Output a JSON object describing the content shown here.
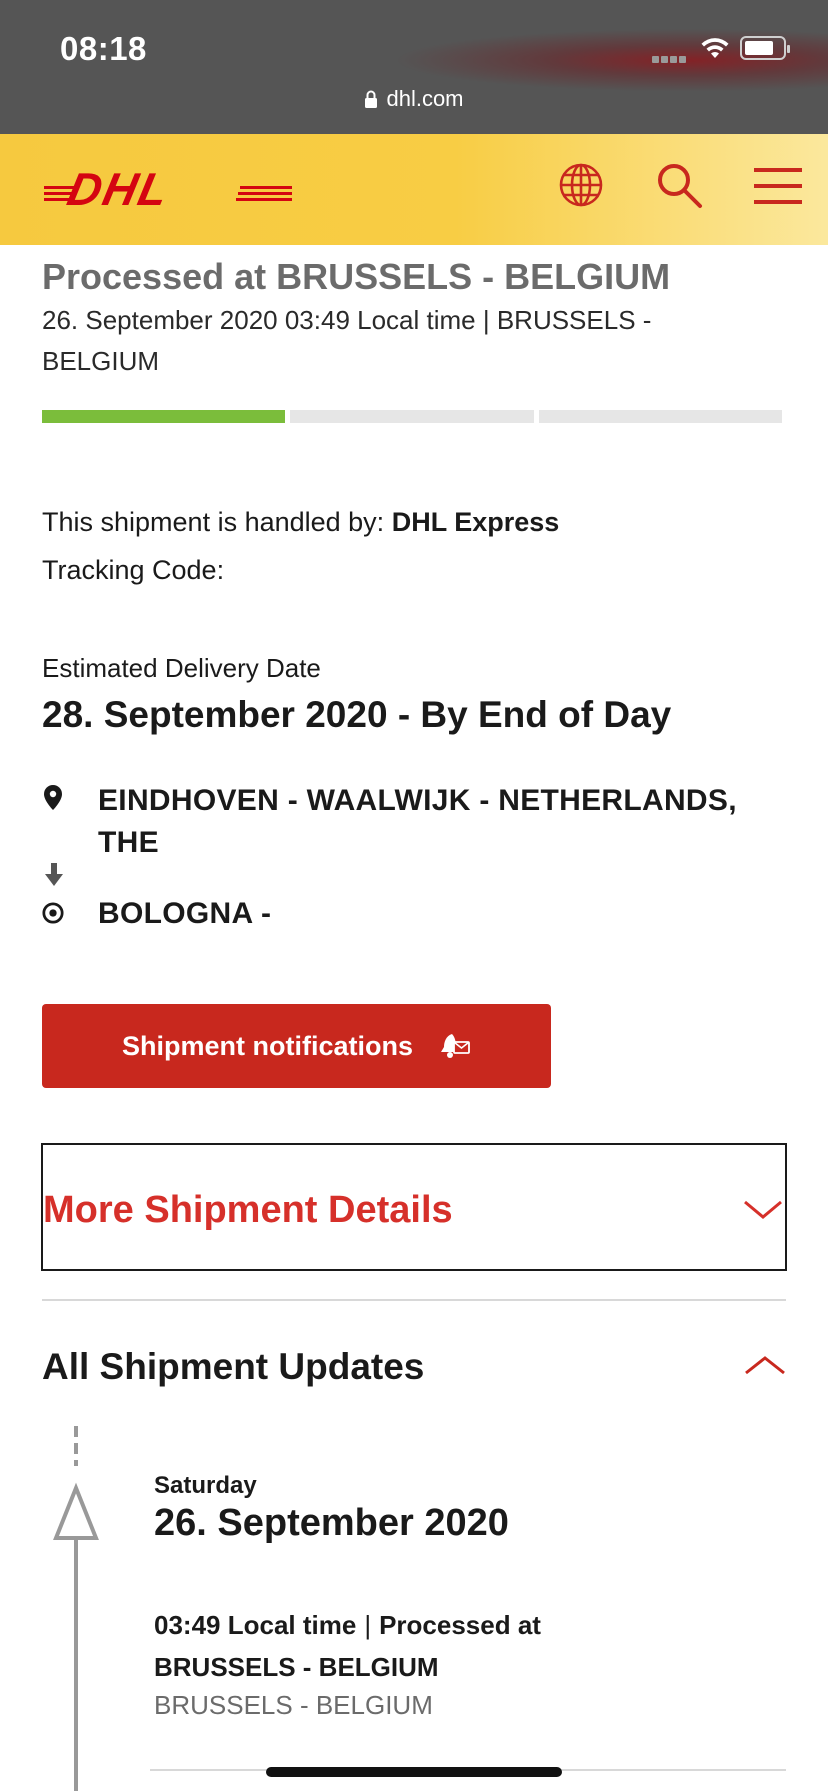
{
  "status_bar": {
    "time": "08:18",
    "url": "dhl.com"
  },
  "header": {
    "logo_text": "DHL",
    "icons": [
      "globe-icon",
      "search-icon",
      "menu-icon"
    ]
  },
  "shipment": {
    "status_title": "Processed at BRUSSELS - BELGIUM",
    "status_detail": "26. September 2020 03:49 Local time | BRUSSELS - BELGIUM",
    "progress": {
      "completed_steps": 1,
      "total_steps": 3
    },
    "handled_by_label": "This shipment is handled by:",
    "handled_by_value": "DHL Express",
    "tracking_code_label": "Tracking Code:",
    "eta_label": "Estimated Delivery Date",
    "eta_value": "28. September 2020 - By End of Day",
    "origin": "EINDHOVEN - WAALWIJK - NETHERLANDS, THE",
    "destination": "BOLOGNA -"
  },
  "buttons": {
    "notifications": "Shipment notifications"
  },
  "sections": {
    "more_details": "More Shipment Details",
    "all_updates": "All Shipment Updates"
  },
  "updates": [
    {
      "weekday": "Saturday",
      "date": "26. September 2020",
      "time": "03:49 Local time",
      "separator": "|",
      "description": "Processed at BRUSSELS - BELGIUM",
      "location": "BRUSSELS - BELGIUM"
    }
  ],
  "colors": {
    "dhl_red": "#d40511",
    "dhl_yellow": "#ffcc00",
    "progress_green": "#7bbd3b"
  }
}
